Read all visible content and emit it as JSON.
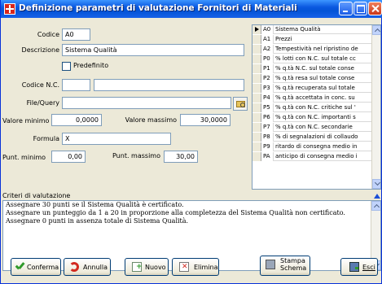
{
  "window": {
    "title": "Definizione parametri di valutazione Fornitori di Materiali",
    "accent": "#0a58e0"
  },
  "form": {
    "codice_label": "Codice",
    "codice_value": "A0",
    "descrizione_label": "Descrizione",
    "descrizione_value": "Sistema Qualità",
    "predefinito_label": "Predefinito",
    "predefinito_checked": false,
    "codice_nc_label": "Codice N.C.",
    "codice_nc_value": "",
    "codice_nc_desc": "",
    "file_query_label": "File/Query",
    "file_query_value": "",
    "valore_minimo_label": "Valore minimo",
    "valore_minimo_value": "0,0000",
    "valore_massimo_label": "Valore massimo",
    "valore_massimo_value": "30,0000",
    "formula_label": "Formula",
    "formula_value": "X",
    "punt_minimo_label": "Punt. minimo",
    "punt_minimo_value": "0,00",
    "punt_massimo_label": "Punt. massimo",
    "punt_massimo_value": "30,00"
  },
  "grid": {
    "rows": [
      {
        "code": "A0",
        "desc": "Sistema Qualità",
        "selected": true
      },
      {
        "code": "A1",
        "desc": "Prezzi"
      },
      {
        "code": "A2",
        "desc": "Tempestività nel ripristino de"
      },
      {
        "code": "P0",
        "desc": "% lotti con N.C. sul totale cc"
      },
      {
        "code": "P1",
        "desc": "% q.tà N.C. sul totale conse"
      },
      {
        "code": "P2",
        "desc": "% q.tà resa sul totale conse"
      },
      {
        "code": "P3",
        "desc": "% q.tà recuperata sul totale"
      },
      {
        "code": "P4",
        "desc": "% q.tà accettata in conc. su"
      },
      {
        "code": "P5",
        "desc": "% q.tà con N.C. critiche sul '"
      },
      {
        "code": "P6",
        "desc": "% q.tà con N.C. importanti s"
      },
      {
        "code": "P7",
        "desc": "% q.tà con N.C. secondarie"
      },
      {
        "code": "P8",
        "desc": "% di segnalazioni di collaudo"
      },
      {
        "code": "P9",
        "desc": "ritardo di consegna medio in"
      },
      {
        "code": "PA",
        "desc": "anticipo di consegna medio i"
      }
    ]
  },
  "criteri": {
    "label": "Criteri di valutazione",
    "lines": [
      "Assegnare 30 punti se il Sistema Qualità è certificato.",
      "Assegnare un punteggio da 1 a 20 in proporzione alla completezza del Sistema Qualità non certificato.",
      "Assegnare 0 punti in assenza totale di Sistema Qualità."
    ]
  },
  "buttons": {
    "conferma": "Conferma",
    "annulla": "Annulla",
    "nuovo": "Nuovo",
    "elimina": "Elimina",
    "stampa_1": "Stampa",
    "stampa_2": "Schema",
    "esci": "Esci"
  }
}
